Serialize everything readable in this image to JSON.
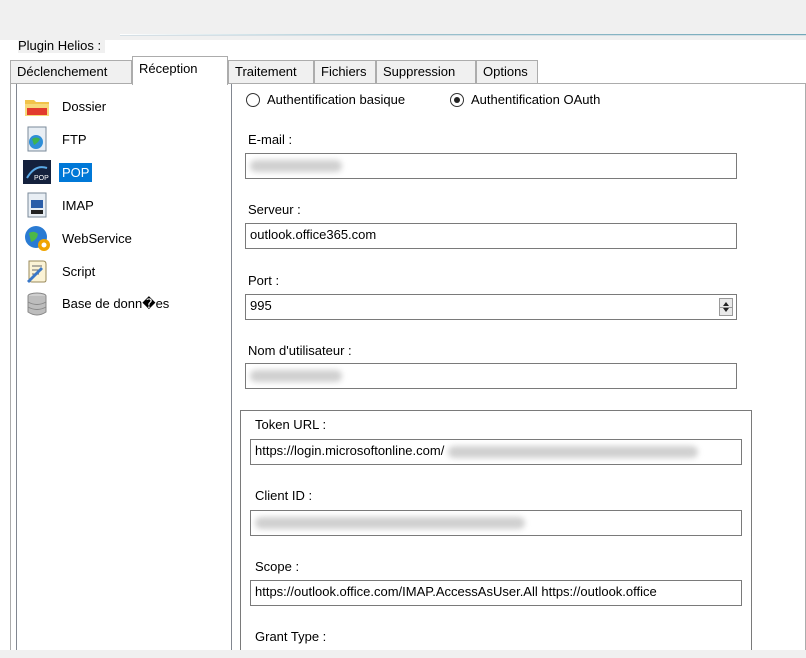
{
  "window": {
    "group_label": "Plugin Helios :"
  },
  "tabs": [
    {
      "label": "Déclenchement",
      "active": false
    },
    {
      "label": "Réception",
      "active": true
    },
    {
      "label": "Traitement",
      "active": false
    },
    {
      "label": "Fichiers",
      "active": false
    },
    {
      "label": "Suppression",
      "active": false
    },
    {
      "label": "Options",
      "active": false
    }
  ],
  "protocols": [
    {
      "label": "Dossier",
      "icon": "folder-icon",
      "selected": false
    },
    {
      "label": "FTP",
      "icon": "ftp-globe-icon",
      "selected": false
    },
    {
      "label": "POP",
      "icon": "pop-icon",
      "selected": true
    },
    {
      "label": "IMAP",
      "icon": "imap-icon",
      "selected": false
    },
    {
      "label": "WebService",
      "icon": "web-service-icon",
      "selected": false
    },
    {
      "label": "Script",
      "icon": "script-icon",
      "selected": false
    },
    {
      "label": "Base de donn�es",
      "icon": "database-icon",
      "selected": false
    }
  ],
  "auth": {
    "basic_label": "Authentification basique",
    "oauth_label": "Authentification OAuth",
    "selected": "oauth"
  },
  "form": {
    "email_label": "E-mail :",
    "server_label": "Serveur :",
    "server_value": "outlook.office365.com",
    "port_label": "Port :",
    "port_value": "995",
    "username_label": "Nom d'utilisateur :"
  },
  "oauth": {
    "token_url_label": "Token URL :",
    "token_url_value": "https://login.microsoftonline.com/",
    "client_id_label": "Client ID :",
    "scope_label": "Scope :",
    "scope_value": "https://outlook.office.com/IMAP.AccessAsUser.All https://outlook.office",
    "grant_type_label": "Grant Type :"
  },
  "colors": {
    "selection": "#0078d7",
    "window_bg": "#f0f0f0"
  }
}
